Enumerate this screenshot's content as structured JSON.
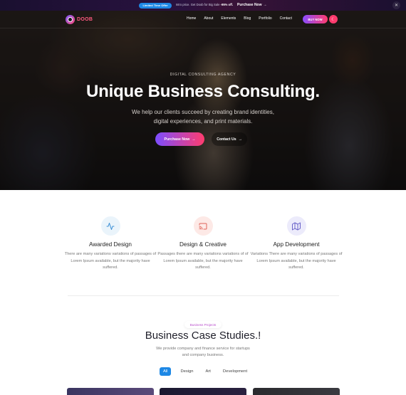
{
  "promo": {
    "badge": "Limited Time Offer",
    "text_prefix": "Intro price. Get Doob for Big Sale ",
    "discount": "-95% off.",
    "link": "Purchase Now",
    "link_arrow": "→",
    "close": "✕"
  },
  "nav": {
    "logo_text": "DOOB",
    "items": [
      "Home",
      "About",
      "Elements",
      "Blog",
      "Portfolio",
      "Contact"
    ],
    "buy_label": "BUY NOW",
    "theme_icon": "☾"
  },
  "hero": {
    "kicker": "DIGITAL CONSULTING AGENCY",
    "title": "Unique Business Consulting.",
    "description": "We help our clients succeed by creating brand identities, digital experiences, and print materials.",
    "primary_button": "Purchase Now",
    "secondary_button": "Contact Us",
    "arrow": "→"
  },
  "services": [
    {
      "title": "Awarded Design",
      "description": "There are many variations variations of passages of Lorem Ipsum available, but the majority have suffered.",
      "icon": "activity-icon",
      "icon_bg": "#eaf4fb",
      "icon_color": "#3a8fd6"
    },
    {
      "title": "Design & Creative",
      "description": "Passages there are many variations variations of of Lorem Ipsum available, but the majority have suffered.",
      "icon": "cast-icon",
      "icon_bg": "#fde9e6",
      "icon_color": "#e0645a"
    },
    {
      "title": "App Development",
      "description": "Variations There are many variations of passages of Lorem Ipsum available, but the majority have suffered.",
      "icon": "map-icon",
      "icon_bg": "#ecebfb",
      "icon_color": "#6a63c9"
    }
  ],
  "case_studies": {
    "badge": "Business Projects",
    "title": "Business Case Studies.!",
    "description": "We provide company and finance service for startups and company business.",
    "filters": [
      "All",
      "Design",
      "Art",
      "Development"
    ],
    "active_filter": "All"
  },
  "colors": {
    "accent_blue": "#1e88e5",
    "gradient_start": "#7c4dff",
    "gradient_end": "#ff3c6e"
  }
}
